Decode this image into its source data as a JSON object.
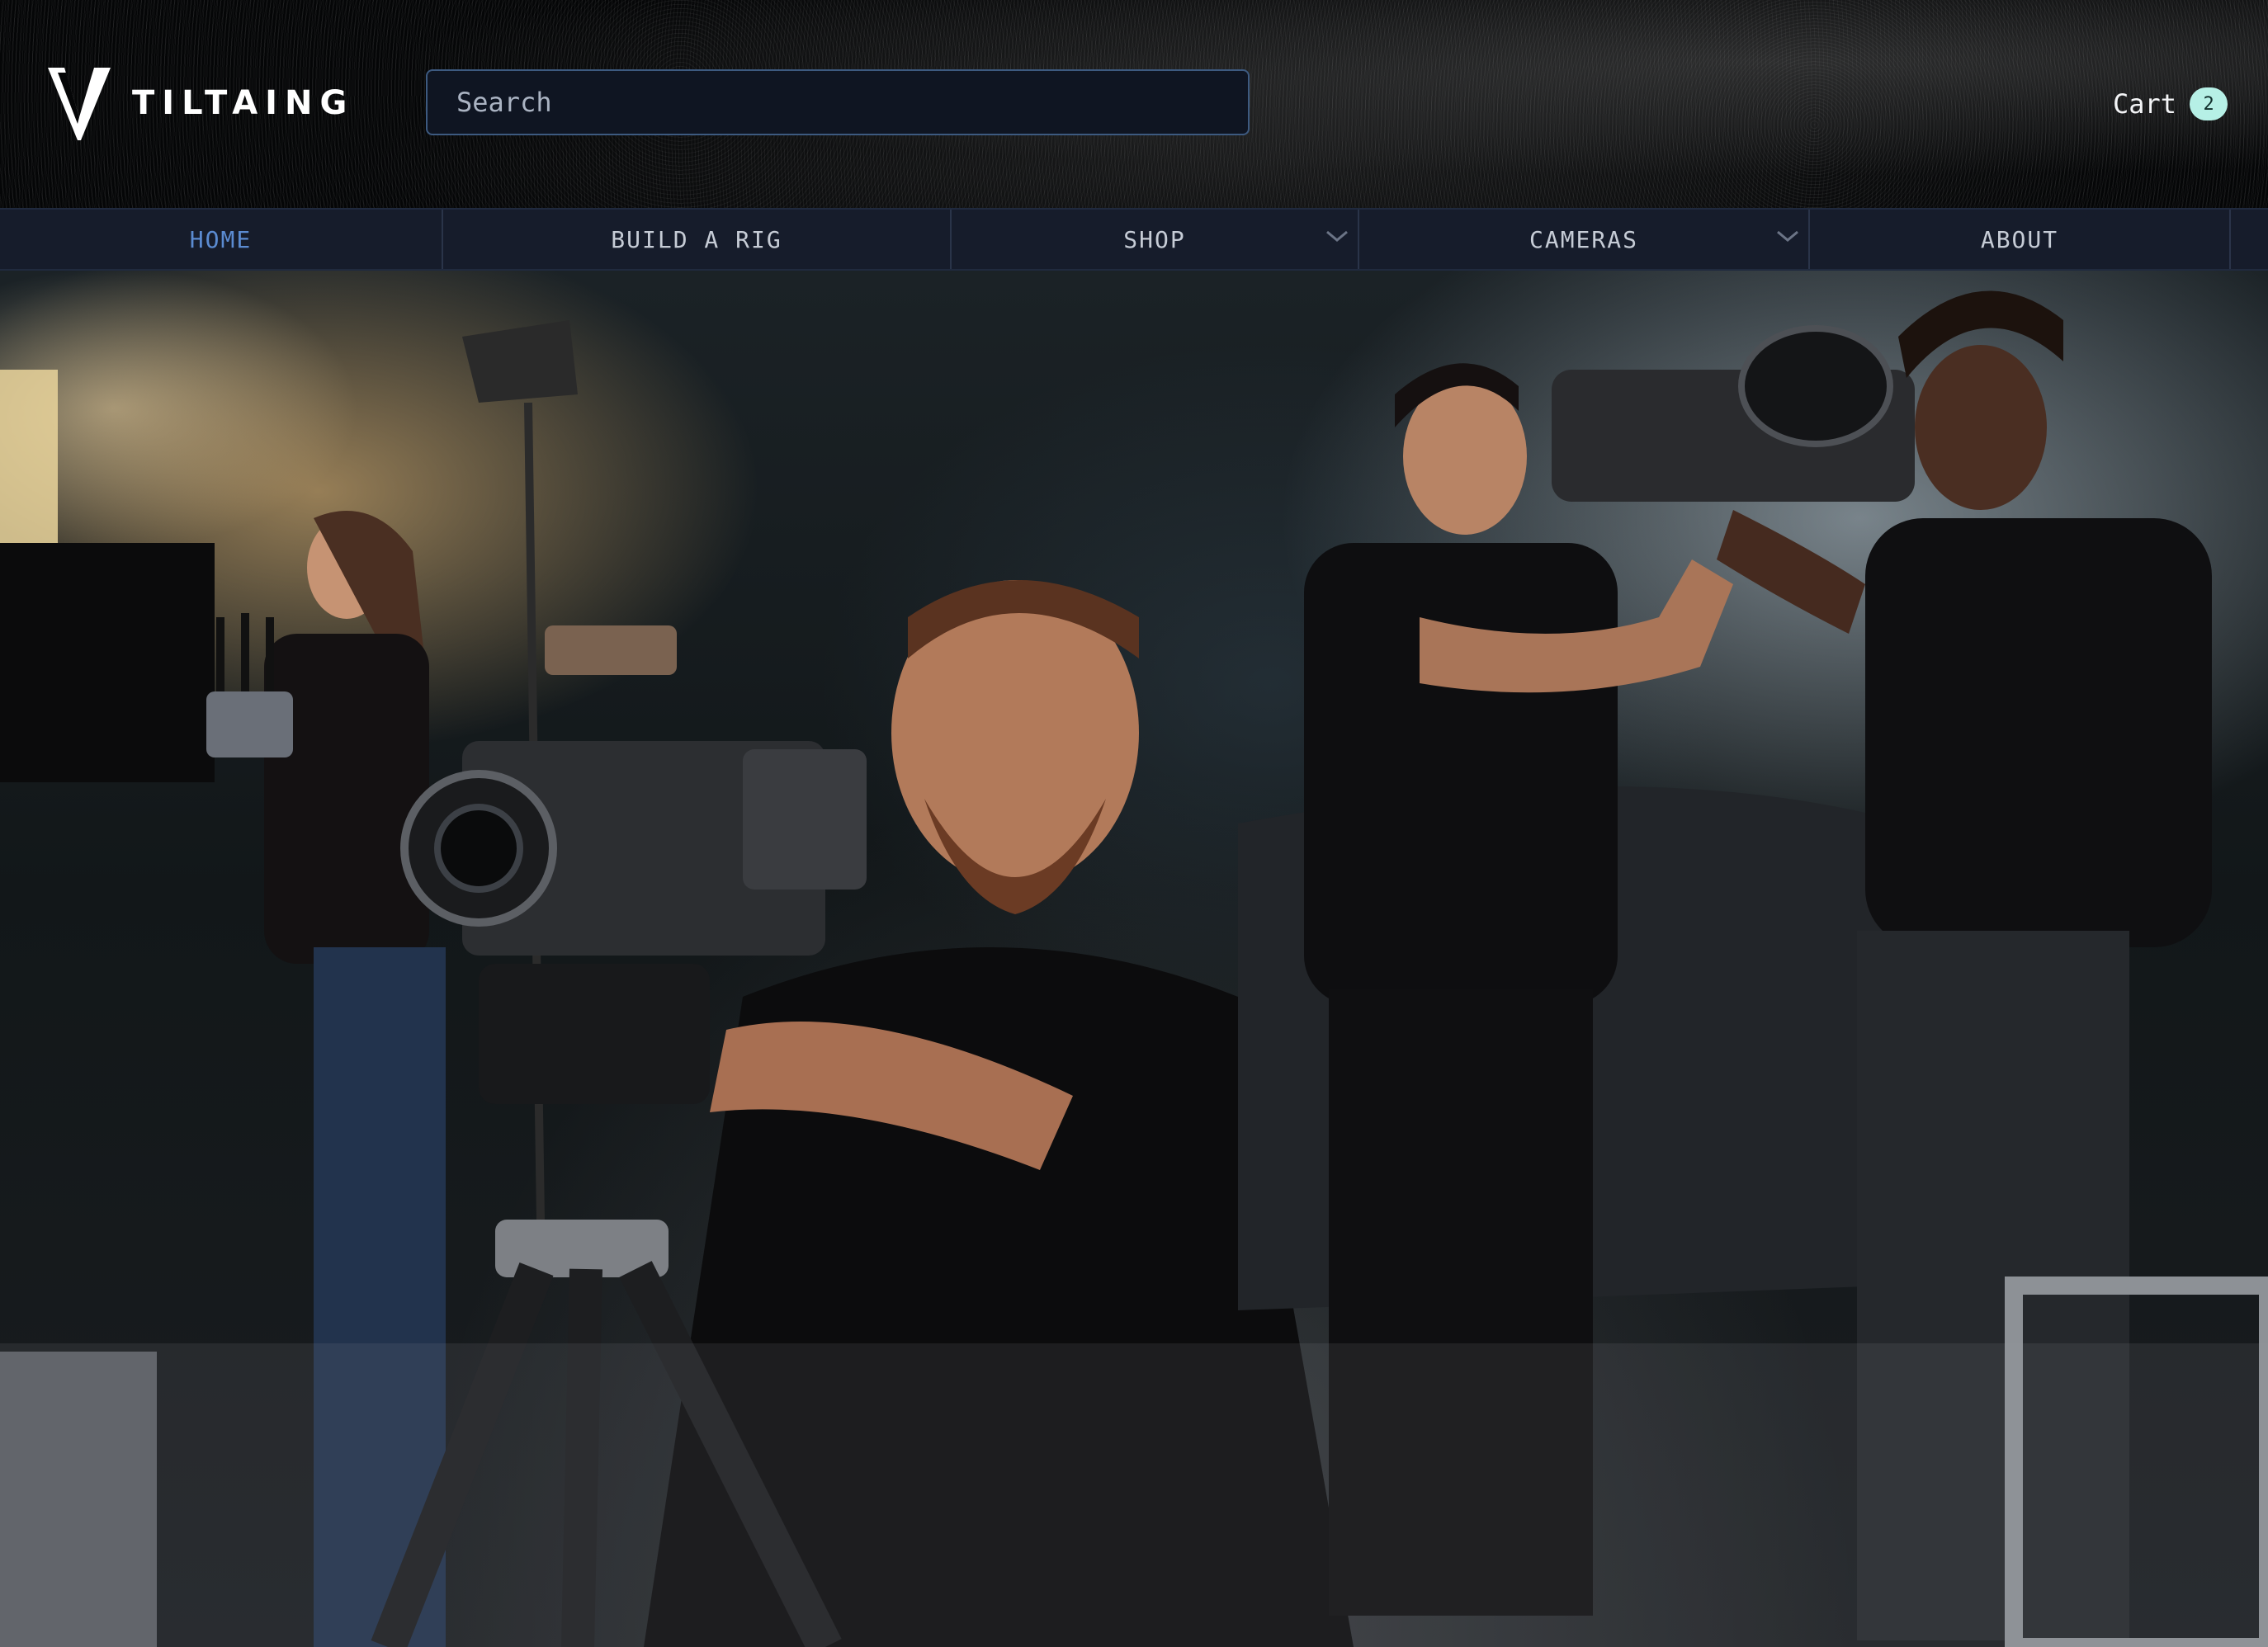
{
  "brand": {
    "name": "TILTAING"
  },
  "search": {
    "placeholder": "Search"
  },
  "cart": {
    "label": "Cart",
    "count": "2"
  },
  "nav": {
    "items": [
      {
        "label": "HOME",
        "active": true,
        "has_dropdown": false
      },
      {
        "label": "BUILD A RIG",
        "active": false,
        "has_dropdown": false
      },
      {
        "label": "SHOP",
        "active": false,
        "has_dropdown": true
      },
      {
        "label": "CAMERAS",
        "active": false,
        "has_dropdown": true
      },
      {
        "label": "ABOUT",
        "active": false,
        "has_dropdown": false
      }
    ]
  },
  "hero": {
    "image": "Film crew operating Tilta camera rigs in a dark studio"
  },
  "colors": {
    "nav_bg": "#161c2b",
    "nav_active": "#5b8bd1",
    "search_border": "#3d5a80",
    "cart_badge": "#b6f0e6"
  },
  "icons": [
    "tilta-logo-icon",
    "chevron-down-icon"
  ]
}
